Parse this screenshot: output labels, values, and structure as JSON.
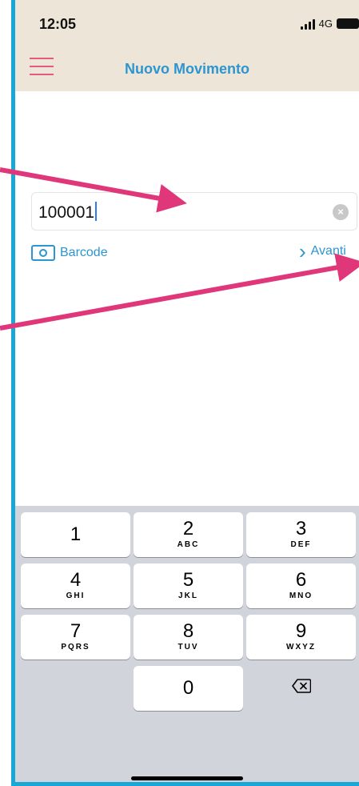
{
  "status_bar": {
    "time": "12:05",
    "network": "4G"
  },
  "nav": {
    "title": "Nuovo Movimento",
    "menu_icon": "hamburger-menu-icon"
  },
  "search": {
    "value": "100001",
    "clear_icon": "clear-icon"
  },
  "actions": {
    "barcode_label": "Barcode",
    "avanti_label": "Avanti"
  },
  "keypad": {
    "keys": [
      {
        "digit": "1",
        "letters": ""
      },
      {
        "digit": "2",
        "letters": "ABC"
      },
      {
        "digit": "3",
        "letters": "DEF"
      },
      {
        "digit": "4",
        "letters": "GHI"
      },
      {
        "digit": "5",
        "letters": "JKL"
      },
      {
        "digit": "6",
        "letters": "MNO"
      },
      {
        "digit": "7",
        "letters": "PQRS"
      },
      {
        "digit": "8",
        "letters": "TUV"
      },
      {
        "digit": "9",
        "letters": "WXYZ"
      },
      {
        "digit": "0",
        "letters": ""
      }
    ],
    "delete_icon": "backspace-icon"
  },
  "colors": {
    "accent": "#2d95cf",
    "annotation": "#e0377a",
    "header_bg": "#ece5d8",
    "frame": "#18a7d6"
  }
}
